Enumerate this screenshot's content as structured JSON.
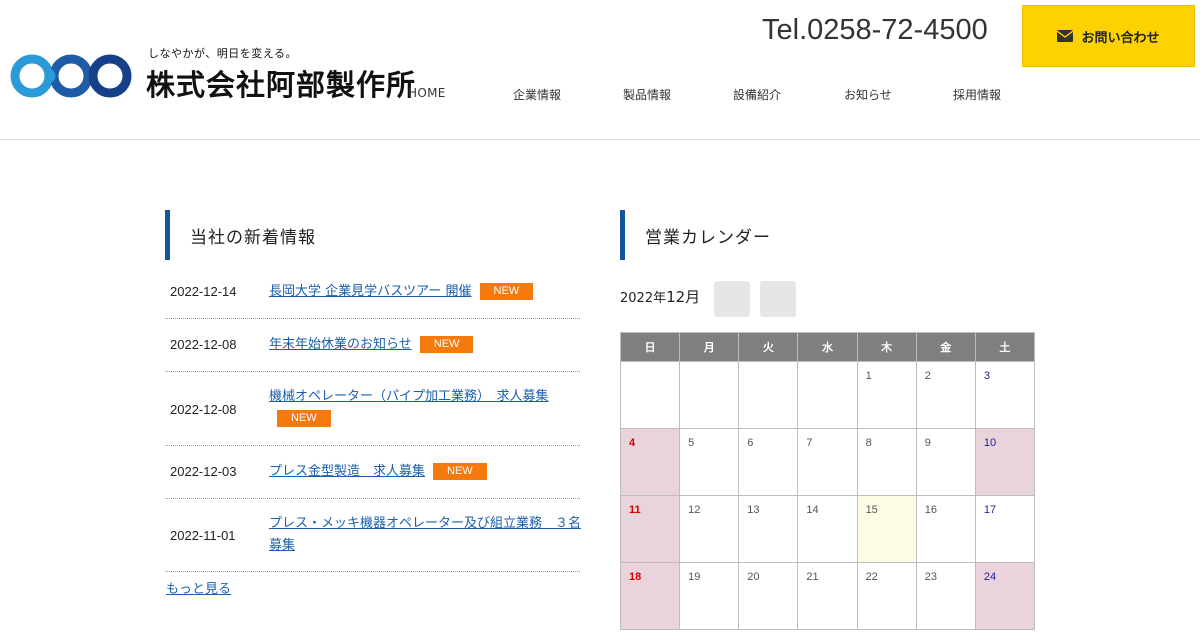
{
  "header": {
    "tagline": "しなやかが、明日を変える。",
    "company_name": "株式会社阿部製作所",
    "tel": "Tel.0258-72-4500",
    "contact_label": "お問い合わせ",
    "nav": [
      "HOME",
      "企業情報",
      "製品情報",
      "設備紹介",
      "お知らせ",
      "採用情報"
    ]
  },
  "news": {
    "heading": "当社の新着情報",
    "items": [
      {
        "date": "2022-12-14",
        "title": "長岡大学 企業見学バスツアー 開催",
        "badge": "NEW"
      },
      {
        "date": "2022-12-08",
        "title": "年末年始休業のお知らせ",
        "badge": "NEW"
      },
      {
        "date": "2022-12-08",
        "title": "機械オペレーター（パイプ加工業務）　求人募集",
        "badge": "NEW"
      },
      {
        "date": "2022-12-03",
        "title": "プレス金型製造　求人募集",
        "badge": "NEW"
      },
      {
        "date": "2022-11-01",
        "title": "プレス・メッキ機器オペレーター及び組立業務　３名募集",
        "badge": ""
      }
    ],
    "more_label": "もっと見る"
  },
  "calendar": {
    "heading": "営業カレンダー",
    "year_label": "2022年",
    "month_label": "12月",
    "weekdays": [
      "日",
      "月",
      "火",
      "水",
      "木",
      "金",
      "土"
    ],
    "weeks": [
      [
        "",
        "",
        "",
        "",
        "1",
        "2",
        "3"
      ],
      [
        "4",
        "5",
        "6",
        "7",
        "8",
        "9",
        "10"
      ],
      [
        "11",
        "12",
        "13",
        "14",
        "15",
        "16",
        "17"
      ],
      [
        "18",
        "19",
        "20",
        "21",
        "22",
        "23",
        "24"
      ]
    ],
    "holidays": [
      "4",
      "10",
      "11",
      "18",
      "24"
    ],
    "today": "15",
    "colors": {
      "holiday_bg": "#e9d4dc",
      "today_bg": "#fdfbe3",
      "sunday": "#d40000",
      "saturday": "#1d1d9a"
    }
  },
  "colors": {
    "accent": "#17559b",
    "button": "#fdd200",
    "badge": "#f47a0e",
    "link": "#1a5fae"
  }
}
